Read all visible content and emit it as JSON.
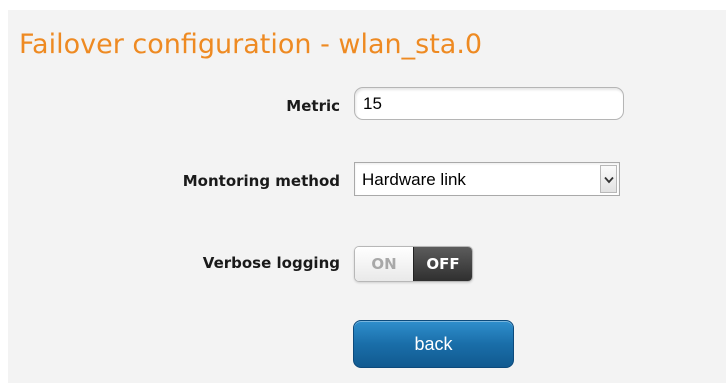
{
  "page": {
    "title": "Failover configuration - wlan_sta.0"
  },
  "form": {
    "metric": {
      "label": "Metric",
      "value": "15"
    },
    "monitoring_method": {
      "label": "Montoring method",
      "selected": "Hardware link"
    },
    "verbose_logging": {
      "label": "Verbose logging",
      "on_label": "ON",
      "off_label": "OFF",
      "state": "OFF"
    },
    "back_label": "back"
  },
  "colors": {
    "title": "#ee8a22",
    "panel_bg": "#f3f3f3",
    "button_blue": "#1a6ea9",
    "toggle_off_bg": "#3a3a3a"
  },
  "icons": {
    "select_arrow": "chevron-down-icon"
  }
}
